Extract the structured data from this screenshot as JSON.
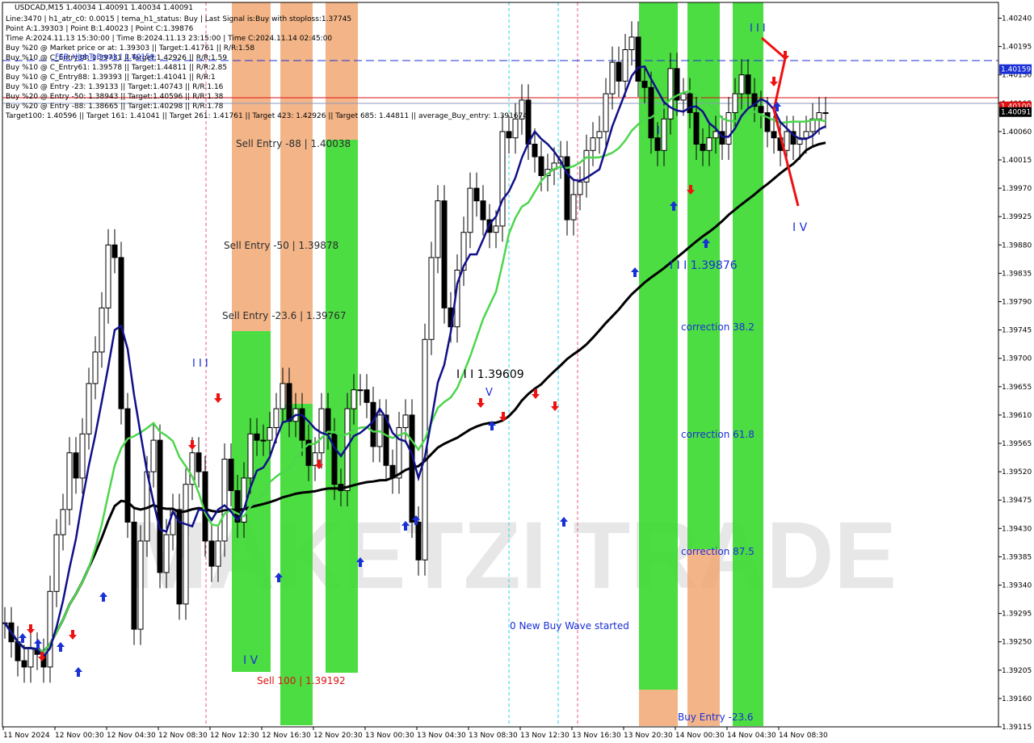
{
  "chart_data": {
    "type": "candlestick",
    "symbol": "USDCAD,M15",
    "ylim": [
      1.39115,
      1.40265
    ],
    "y_ticks": [
      "1.40240",
      "1.40195",
      "1.40150",
      "1.40105",
      "1.40060",
      "1.40015",
      "1.39970",
      "1.39925",
      "1.39880",
      "1.39835",
      "1.39790",
      "1.39745",
      "1.39700",
      "1.39655",
      "1.39610",
      "1.39565",
      "1.39520",
      "1.39475",
      "1.39430",
      "1.39385",
      "1.39340",
      "1.39295",
      "1.39250",
      "1.39205",
      "1.39160",
      "1.39115"
    ],
    "x_ticks": [
      "11 Nov 2024",
      "12 Nov 00:30",
      "12 Nov 04:30",
      "12 Nov 08:30",
      "12 Nov 12:30",
      "12 Nov 16:30",
      "12 Nov 20:30",
      "13 Nov 00:30",
      "13 Nov 04:30",
      "13 Nov 08:30",
      "13 Nov 12:30",
      "13 Nov 16:30",
      "13 Nov 20:30",
      "14 Nov 00:30",
      "14 Nov 04:30",
      "14 Nov 08:30"
    ],
    "price_labels": [
      {
        "text": "1.40159",
        "value": 1.40159,
        "color": "#1a2fd6"
      },
      {
        "text": "1.40100",
        "value": 1.401,
        "color": "#dd1111"
      },
      {
        "text": "1.40091",
        "value": 1.40091,
        "color": "#000000"
      }
    ],
    "info_lines": [
      "USDCAD,M15  1.40034 1.40091 1.40034 1.40091",
      "Line:3470 | h1_atr_c0: 0.0015 | tema_h1_status: Buy | Last Signal is:Buy with stoploss:1.37745",
      "Point A:1.39303 | Point B:1.40023 | Point C:1.39876",
      "Time A:2024.11.13 15:30:00 | Time B:2024.11.13 23:15:00 | Time C:2024.11.14 02:45:00",
      "Buy %20 @ Market price or at: 1.39303 || Target:1.41761 || R/R:1.58",
      "Buy %10 @ C_Entry38: 1.39731 || Target:1.42926 || R/R:1.59",
      "Buy %10 @ C_Entry61: 1.39578 || Target:1.44811 || R/R:2.85",
      "Buy %10 @ C_Entry88: 1.39393 || Target:1.41041 || R/R:1",
      "Buy %10 @ Entry -23: 1.39133 || Target:1.40743 || R/R:1.16",
      "Buy %20 @ Entry -50: 1.38943 || Target:1.40596 || R/R:1.38",
      "Buy %20 @ Entry -88: 1.38665 || Target:1.40298 || R/R:1.78",
      "Target100: 1.40596 || Target 161: 1.41041 || Target 261: 1.41761 || Target 423: 1.42926 || Target 685: 1.44811 || average_Buy_entry: 1.391674"
    ],
    "overlap_text": "FSB_HighToBreak | 1.40159",
    "annotations": [
      {
        "text": "Sell Entry -88 | 1.40038"
      },
      {
        "text": "Sell Entry -50 | 1.39878"
      },
      {
        "text": "Sell Entry -23.6 | 1.39767"
      },
      {
        "text": "I I I 1.39609"
      },
      {
        "text": "V"
      },
      {
        "text": "I I I"
      },
      {
        "text": "I V"
      },
      {
        "text": "Sell 100 | 1.39192"
      },
      {
        "text": "0 New Buy Wave started"
      },
      {
        "text": "I"
      },
      {
        "text": "I I I 1.39876"
      },
      {
        "text": "correction 38.2"
      },
      {
        "text": "correction 61.8"
      },
      {
        "text": "correction 87.5"
      },
      {
        "text": "Buy Entry -23.6"
      },
      {
        "text": "I I I"
      },
      {
        "text": "I V"
      }
    ],
    "watermark": "MAKETZI TRADE",
    "series": [
      {
        "name": "",
        "kind": "close",
        "x": [
          0,
          2,
          4,
          6,
          8,
          10,
          12,
          14,
          16,
          18,
          20,
          22,
          24,
          26,
          28,
          30,
          32,
          34,
          36,
          38,
          40,
          42,
          44,
          46,
          48,
          50,
          52,
          54,
          56,
          58,
          60,
          62,
          64,
          66,
          68,
          70,
          72,
          74,
          76,
          78,
          80,
          82,
          84,
          86,
          88,
          90,
          92,
          94,
          96,
          98,
          100,
          102,
          104,
          106,
          108,
          110,
          112,
          114,
          116,
          118,
          120,
          122,
          124,
          126,
          128,
          130,
          132,
          134,
          136,
          138,
          140,
          142,
          144,
          146,
          148,
          150,
          152,
          154,
          156,
          158,
          160,
          162,
          164,
          166,
          168,
          170,
          172,
          174,
          176,
          178,
          180,
          182,
          184,
          186,
          188,
          190,
          192,
          194,
          196,
          198,
          200,
          202,
          204,
          206,
          208,
          210,
          212,
          214,
          216,
          218,
          220,
          222,
          224,
          226,
          228,
          230,
          232,
          234,
          236,
          238,
          240,
          242,
          244,
          246,
          248,
          250,
          252,
          254
        ],
        "values": [
          1.3928,
          1.3925,
          1.3922,
          1.3921,
          1.3924,
          1.3923,
          1.3921,
          1.3933,
          1.3942,
          1.3946,
          1.3955,
          1.3951,
          1.3958,
          1.3966,
          1.3971,
          1.3978,
          1.3988,
          1.3986,
          1.3962,
          1.3944,
          1.3927,
          1.3941,
          1.3952,
          1.3957,
          1.3936,
          1.3942,
          1.3946,
          1.3931,
          1.395,
          1.3955,
          1.3952,
          1.3941,
          1.3937,
          1.3941,
          1.3954,
          1.3949,
          1.3944,
          1.3951,
          1.3958,
          1.3957,
          1.3957,
          1.3959,
          1.3962,
          1.3966,
          1.396,
          1.3962,
          1.3957,
          1.3953,
          1.3955,
          1.3962,
          1.3958,
          1.395,
          1.3949,
          1.3962,
          1.3965,
          1.3965,
          1.3963,
          1.3956,
          1.3961,
          1.3953,
          1.3951,
          1.3959,
          1.3961,
          1.3944,
          1.3938,
          1.3973,
          1.3986,
          1.3995,
          1.3978,
          1.3975,
          1.3984,
          1.399,
          1.3997,
          1.3995,
          1.3992,
          1.399,
          1.3991,
          1.4006,
          1.4005,
          1.4008,
          1.4011,
          1.4004,
          1.4002,
          1.3999,
          1.4,
          1.4001,
          1.4002,
          1.3992,
          1.3996,
          1.3998,
          1.4003,
          1.4005,
          1.4006,
          1.4012,
          1.4017,
          1.4014,
          1.4019,
          1.4021,
          1.4014,
          1.4013,
          1.4005,
          1.4003,
          1.4008,
          1.4016,
          1.4011,
          1.4012,
          1.4009,
          1.4004,
          1.4003,
          1.4005,
          1.4006,
          1.4004,
          1.4009,
          1.4012,
          1.4015,
          1.4012,
          1.401,
          1.4009,
          1.4006,
          1.4005,
          1.4003,
          1.4006,
          1.4004,
          1.4005,
          1.4006,
          1.4008,
          1.4009,
          1.4009
        ]
      }
    ]
  }
}
